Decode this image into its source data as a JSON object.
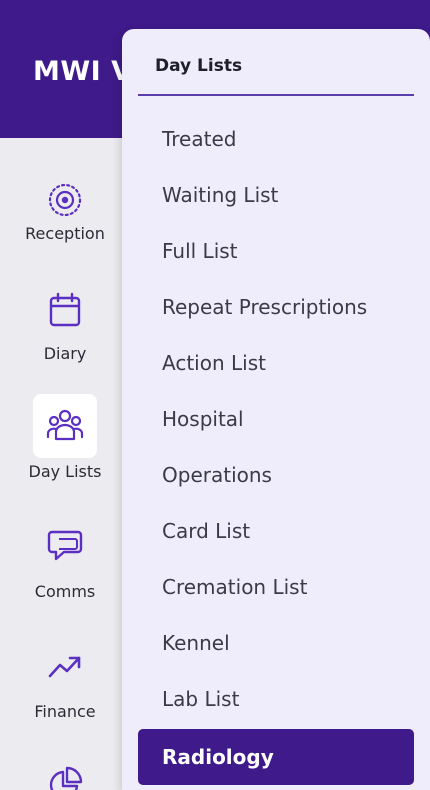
{
  "header": {
    "app_title": "MWI V"
  },
  "sidebar": {
    "items": [
      {
        "label": "Reception",
        "icon": "target-icon"
      },
      {
        "label": "Diary",
        "icon": "calendar-icon"
      },
      {
        "label": "Day Lists",
        "icon": "users-icon",
        "active": true
      },
      {
        "label": "Comms",
        "icon": "chat-icon"
      },
      {
        "label": "Finance",
        "icon": "trend-up-icon"
      },
      {
        "label": "",
        "icon": "pie-chart-icon"
      }
    ]
  },
  "flyout": {
    "title": "Day Lists",
    "items": [
      {
        "label": "Treated"
      },
      {
        "label": "Waiting List"
      },
      {
        "label": "Full List"
      },
      {
        "label": "Repeat Prescriptions"
      },
      {
        "label": "Action List"
      },
      {
        "label": "Hospital"
      },
      {
        "label": "Operations"
      },
      {
        "label": "Card List"
      },
      {
        "label": "Cremation List"
      },
      {
        "label": "Kennel"
      },
      {
        "label": "Lab List"
      },
      {
        "label": "Radiology",
        "selected": true
      }
    ]
  },
  "colors": {
    "brand": "#3e1a8a",
    "icon": "#5b2fc2",
    "sidebar_bg": "#ececf0",
    "flyout_bg": "#efedfb"
  }
}
